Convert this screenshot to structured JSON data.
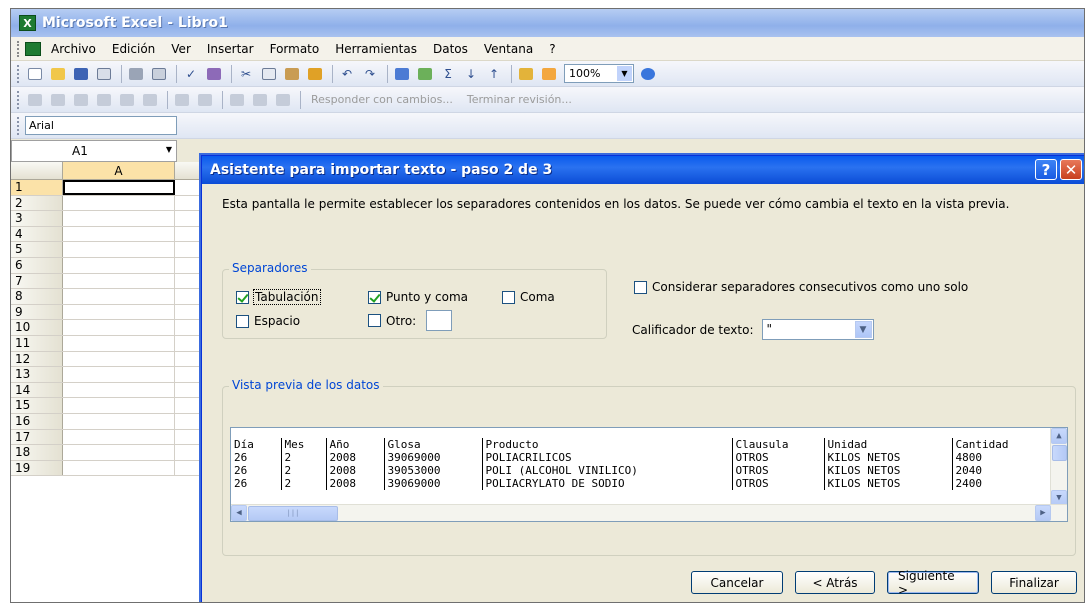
{
  "app": {
    "title": "Microsoft Excel - Libro1"
  },
  "menu": {
    "items": [
      "Archivo",
      "Edición",
      "Ver",
      "Insertar",
      "Formato",
      "Herramientas",
      "Datos",
      "Ventana",
      "?"
    ]
  },
  "toolbar": {
    "zoom": "100%",
    "review_reply": "Responder con cambios...",
    "review_end": "Terminar revisión..."
  },
  "formatting": {
    "font_name": "Arial"
  },
  "namebox": {
    "value": "A1"
  },
  "sheet": {
    "column": "A",
    "rows": [
      "1",
      "2",
      "3",
      "4",
      "5",
      "6",
      "7",
      "8",
      "9",
      "10",
      "11",
      "12",
      "13",
      "14",
      "15",
      "16",
      "17",
      "18",
      "19"
    ]
  },
  "dialog": {
    "title": "Asistente para importar texto - paso 2 de 3",
    "intro": "Esta pantalla le permite establecer los separadores contenidos en los datos. Se puede ver cómo cambia el texto en la vista previa.",
    "separators_label": "Separadores",
    "options": {
      "tab": {
        "label": "Tabulación",
        "checked": true
      },
      "semicolon": {
        "label": "Punto y coma",
        "checked": true
      },
      "comma": {
        "label": "Coma",
        "checked": false
      },
      "space": {
        "label": "Espacio",
        "checked": false
      },
      "other": {
        "label": "Otro:",
        "checked": false
      }
    },
    "consecutive": {
      "label": "Considerar separadores consecutivos como uno solo",
      "checked": false
    },
    "qualifier": {
      "label": "Calificador de texto:",
      "value": "\""
    },
    "preview_label": "Vista previa de los datos",
    "preview": {
      "rows": [
        [
          "Día",
          "Mes",
          "Año",
          "Glosa",
          "Producto",
          "Clausula",
          "Unidad",
          "Cantidad"
        ],
        [
          "26",
          "2",
          "2008",
          "39069000",
          "POLIACRILICOS",
          "OTROS",
          "KILOS NETOS",
          "4800"
        ],
        [
          "26",
          "2",
          "2008",
          "39053000",
          "POLI (ALCOHOL VINILICO)",
          "OTROS",
          "KILOS NETOS",
          "2040"
        ],
        [
          "26",
          "2",
          "2008",
          "39069000",
          "POLIACRYLATO DE SODIO",
          "OTROS",
          "KILOS NETOS",
          "2400"
        ]
      ]
    },
    "buttons": {
      "cancel": "Cancelar",
      "back": "< Atrás",
      "next": "Siguiente >",
      "finish": "Finalizar"
    }
  }
}
